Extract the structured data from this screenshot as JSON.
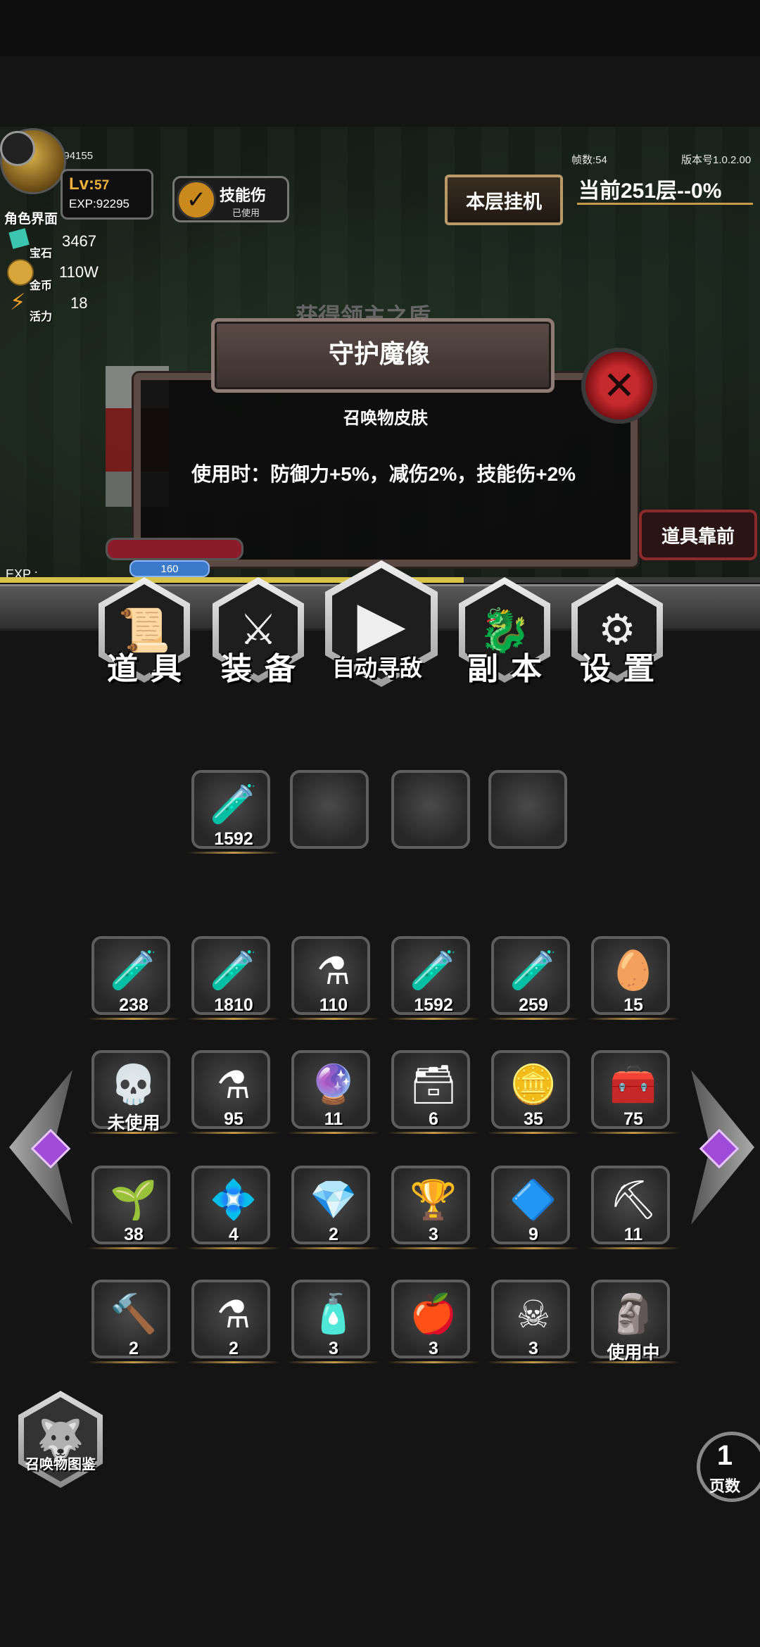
{
  "hud": {
    "player_id": "玩家ID: 27394155",
    "fps": "帧数:54",
    "version": "版本号1.0.2.00",
    "level_prefix": "Lv:",
    "level": "57",
    "exp": "EXP:92295",
    "character_label": "角色界面",
    "gem_label": "宝石",
    "gem_value": "3467",
    "gold_label": "金币",
    "gold_value": "110W",
    "energy_label": "活力",
    "energy_value": "18",
    "skill_label": "技能伤",
    "skill_sub": "已使用",
    "afk_button": "本层挂机",
    "floor_progress": "当前251层--0%",
    "scene_banner": "获得领主之盾",
    "mp_value": "160",
    "exp_bar_label": "EXP :",
    "exp_progress": 0.61
  },
  "dialog": {
    "title": "守护魔像",
    "subtitle": "召唤物皮肤",
    "description": "使用时：防御力+5%，减伤2%，技能伤+2%",
    "front_button": "道具靠前"
  },
  "menu": [
    {
      "label": "道具",
      "icon": "scroll-icon",
      "glyph": "📜"
    },
    {
      "label": "装备",
      "icon": "sword-icon",
      "glyph": "⚔"
    },
    {
      "label": "自动寻敌",
      "icon": "play-icon",
      "glyph": "▶"
    },
    {
      "label": "副本",
      "icon": "dragon-icon",
      "glyph": "🐉"
    },
    {
      "label": "设置",
      "icon": "gear-icon",
      "glyph": "⚙"
    }
  ],
  "quick_slots": [
    {
      "icon": "red-potion-icon",
      "glyph": "🧪",
      "count": "1592"
    },
    {
      "icon": "empty-slot",
      "glyph": "",
      "count": ""
    },
    {
      "icon": "empty-slot",
      "glyph": "",
      "count": ""
    },
    {
      "icon": "empty-slot",
      "glyph": "",
      "count": ""
    }
  ],
  "inventory": [
    {
      "icon": "blue-potion-icon",
      "glyph": "🧪",
      "count": "238"
    },
    {
      "icon": "blue-vial-icon",
      "glyph": "🧪",
      "count": "1810"
    },
    {
      "icon": "blue-flask-icon",
      "glyph": "⚗",
      "count": "110"
    },
    {
      "icon": "pink-vial-icon",
      "glyph": "🧪",
      "count": "1592"
    },
    {
      "icon": "red-potion-icon",
      "glyph": "🧪",
      "count": "259"
    },
    {
      "icon": "golden-egg-icon",
      "glyph": "🥚",
      "count": "15"
    },
    {
      "icon": "skeleton-icon",
      "glyph": "💀",
      "count": "未使用"
    },
    {
      "icon": "red-flask-icon",
      "glyph": "⚗",
      "count": "95"
    },
    {
      "icon": "purple-crystal-icon",
      "glyph": "🔮",
      "count": "11"
    },
    {
      "icon": "silver-chest-icon",
      "glyph": "🗃",
      "count": "6"
    },
    {
      "icon": "gold-coin-icon",
      "glyph": "🪙",
      "count": "35"
    },
    {
      "icon": "treasure-chest-icon",
      "glyph": "🧰",
      "count": "75"
    },
    {
      "icon": "seed-bag-icon",
      "glyph": "🌱",
      "count": "38"
    },
    {
      "icon": "ornate-gem-icon",
      "glyph": "💠",
      "count": "4"
    },
    {
      "icon": "purple-gem-icon",
      "glyph": "💎",
      "count": "2"
    },
    {
      "icon": "trophy-icon",
      "glyph": "🏆",
      "count": "3"
    },
    {
      "icon": "blue-amulet-icon",
      "glyph": "🔷",
      "count": "9"
    },
    {
      "icon": "pickaxe-icon",
      "glyph": "⛏",
      "count": "11"
    },
    {
      "icon": "hammer-icon",
      "glyph": "🔨",
      "count": "2"
    },
    {
      "icon": "cyan-flask-icon",
      "glyph": "⚗",
      "count": "2"
    },
    {
      "icon": "blue-bottle-icon",
      "glyph": "🧴",
      "count": "3"
    },
    {
      "icon": "red-apple-icon",
      "glyph": "🍎",
      "count": "3"
    },
    {
      "icon": "skull-chest-icon",
      "glyph": "☠",
      "count": "3"
    },
    {
      "icon": "golem-skin-icon",
      "glyph": "🗿",
      "count": "使用中"
    }
  ],
  "footer": {
    "codex_label": "召唤物图鉴",
    "page_number": "1",
    "page_label": "页数"
  },
  "colors": {
    "accent_gold": "#c59a4a",
    "level_orange": "#f0b23a",
    "close_red": "#c42a2e"
  }
}
